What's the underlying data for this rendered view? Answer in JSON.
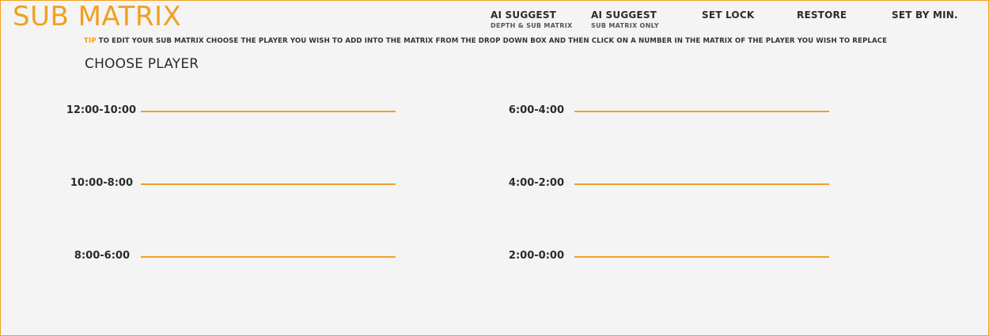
{
  "header": {
    "title": "SUB MATRIX"
  },
  "toolbar": {
    "ai_suggest_depth": {
      "label": "AI SUGGEST",
      "sublabel": "DEPTH & SUB MATRIX"
    },
    "ai_suggest_sub": {
      "label": "AI SUGGEST",
      "sublabel": "SUB MATRIX ONLY"
    },
    "set_lock": {
      "label": "SET LOCK"
    },
    "restore": {
      "label": "RESTORE"
    },
    "set_by_min": {
      "label": "SET BY MIN."
    }
  },
  "tip": {
    "label": "TIP",
    "text": "TO EDIT YOUR SUB MATRIX CHOOSE THE PLAYER YOU WISH TO ADD INTO THE MATRIX FROM THE DROP DOWN BOX AND THEN CLICK ON A NUMBER IN THE MATRIX OF THE PLAYER YOU WISH TO REPLACE"
  },
  "choose_player": {
    "label": "CHOOSE PLAYER"
  },
  "time_slots": {
    "left": [
      {
        "label": "12:00-10:00"
      },
      {
        "label": "10:00-8:00"
      },
      {
        "label": "8:00-6:00"
      }
    ],
    "right": [
      {
        "label": "6:00-4:00"
      },
      {
        "label": "4:00-2:00"
      },
      {
        "label": "2:00-0:00"
      }
    ]
  },
  "colors": {
    "accent": "#f0a021",
    "text": "#2b2b2b",
    "background": "#f4f4f4"
  }
}
